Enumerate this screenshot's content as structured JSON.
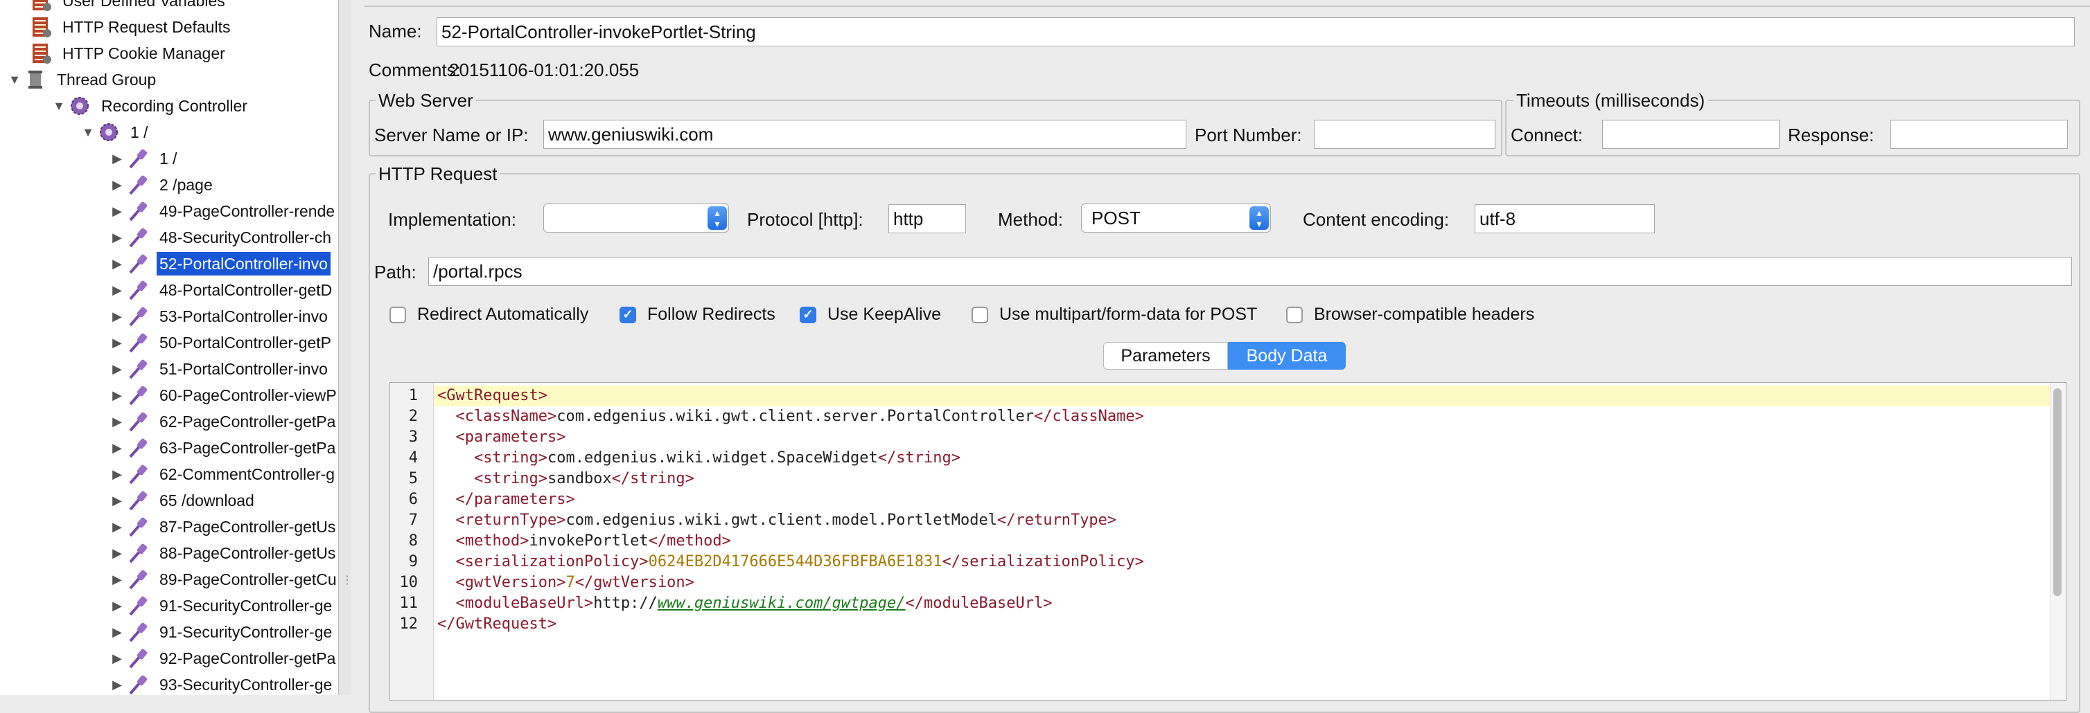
{
  "tree": {
    "items": [
      {
        "label": "User Defined Variables",
        "indent": 0,
        "toggle": "",
        "icon": "config"
      },
      {
        "label": "HTTP Request Defaults",
        "indent": 0,
        "toggle": "",
        "icon": "config"
      },
      {
        "label": "HTTP Cookie Manager",
        "indent": 0,
        "toggle": "",
        "icon": "config"
      },
      {
        "label": "Thread Group",
        "indent": -1,
        "toggle": "▼",
        "icon": "spool"
      },
      {
        "label": "Recording Controller",
        "indent": 1,
        "toggle": "▼",
        "icon": "gear"
      },
      {
        "label": "1 /",
        "indent": 2,
        "toggle": "▼",
        "icon": "gear"
      },
      {
        "label": "1 /",
        "indent": 3,
        "toggle": "▶",
        "icon": "pipette"
      },
      {
        "label": "2 /page",
        "indent": 3,
        "toggle": "▶",
        "icon": "pipette"
      },
      {
        "label": "49-PageController-rende",
        "indent": 3,
        "toggle": "▶",
        "icon": "pipette"
      },
      {
        "label": "48-SecurityController-ch",
        "indent": 3,
        "toggle": "▶",
        "icon": "pipette"
      },
      {
        "label": "52-PortalController-invo",
        "indent": 3,
        "toggle": "▶",
        "icon": "pipette",
        "selected": true
      },
      {
        "label": "48-PortalController-getD",
        "indent": 3,
        "toggle": "▶",
        "icon": "pipette"
      },
      {
        "label": "53-PortalController-invo",
        "indent": 3,
        "toggle": "▶",
        "icon": "pipette"
      },
      {
        "label": "50-PortalController-getP",
        "indent": 3,
        "toggle": "▶",
        "icon": "pipette"
      },
      {
        "label": "51-PortalController-invo",
        "indent": 3,
        "toggle": "▶",
        "icon": "pipette"
      },
      {
        "label": "60-PageController-viewP",
        "indent": 3,
        "toggle": "▶",
        "icon": "pipette"
      },
      {
        "label": "62-PageController-getPa",
        "indent": 3,
        "toggle": "▶",
        "icon": "pipette"
      },
      {
        "label": "63-PageController-getPa",
        "indent": 3,
        "toggle": "▶",
        "icon": "pipette"
      },
      {
        "label": "62-CommentController-g",
        "indent": 3,
        "toggle": "▶",
        "icon": "pipette"
      },
      {
        "label": "65 /download",
        "indent": 3,
        "toggle": "▶",
        "icon": "pipette"
      },
      {
        "label": "87-PageController-getUs",
        "indent": 3,
        "toggle": "▶",
        "icon": "pipette"
      },
      {
        "label": "88-PageController-getUs",
        "indent": 3,
        "toggle": "▶",
        "icon": "pipette"
      },
      {
        "label": "89-PageController-getCu",
        "indent": 3,
        "toggle": "▶",
        "icon": "pipette"
      },
      {
        "label": "91-SecurityController-ge",
        "indent": 3,
        "toggle": "▶",
        "icon": "pipette"
      },
      {
        "label": "91-SecurityController-ge",
        "indent": 3,
        "toggle": "▶",
        "icon": "pipette"
      },
      {
        "label": "92-PageController-getPa",
        "indent": 3,
        "toggle": "▶",
        "icon": "pipette"
      },
      {
        "label": "93-SecurityController-ge",
        "indent": 3,
        "toggle": "▶",
        "icon": "pipette"
      }
    ]
  },
  "form": {
    "name_label": "Name:",
    "name_value": "52-PortalController-invokePortlet-String",
    "comments_label": "Comments:",
    "comments_value": "20151106-01:01:20.055"
  },
  "web_server": {
    "title": "Web Server",
    "server_label": "Server Name or IP:",
    "server_value": "www.geniuswiki.com",
    "port_label": "Port Number:",
    "port_value": ""
  },
  "timeouts": {
    "title": "Timeouts (milliseconds)",
    "connect_label": "Connect:",
    "connect_value": "",
    "response_label": "Response:",
    "response_value": ""
  },
  "http_request": {
    "title": "HTTP Request",
    "implementation_label": "Implementation:",
    "implementation_value": "",
    "protocol_label": "Protocol [http]:",
    "protocol_value": "http",
    "method_label": "Method:",
    "method_value": "POST",
    "encoding_label": "Content encoding:",
    "encoding_value": "utf-8",
    "path_label": "Path:",
    "path_value": "/portal.rpcs",
    "options": [
      {
        "label": "Redirect Automatically",
        "checked": false
      },
      {
        "label": "Follow Redirects",
        "checked": true
      },
      {
        "label": "Use KeepAlive",
        "checked": true
      },
      {
        "label": "Use multipart/form-data for POST",
        "checked": false
      },
      {
        "label": "Browser-compatible headers",
        "checked": false
      }
    ],
    "tabs": [
      {
        "label": "Parameters",
        "active": false
      },
      {
        "label": "Body Data",
        "active": true
      }
    ]
  },
  "body": {
    "line_numbers": [
      "1",
      "2",
      "3",
      "4",
      "5",
      "6",
      "7",
      "8",
      "9",
      "10",
      "11",
      "12"
    ],
    "lines": [
      [
        {
          "t": "tag",
          "s": "<GwtRequest>"
        }
      ],
      [
        {
          "t": "txt",
          "s": "  "
        },
        {
          "t": "tag",
          "s": "<className>"
        },
        {
          "t": "txt",
          "s": "com.edgenius.wiki.gwt.client.server.PortalController"
        },
        {
          "t": "tag",
          "s": "</className>"
        }
      ],
      [
        {
          "t": "txt",
          "s": "  "
        },
        {
          "t": "tag",
          "s": "<parameters>"
        }
      ],
      [
        {
          "t": "txt",
          "s": "    "
        },
        {
          "t": "tag",
          "s": "<string>"
        },
        {
          "t": "txt",
          "s": "com.edgenius.wiki.widget.SpaceWidget"
        },
        {
          "t": "tag",
          "s": "</string>"
        }
      ],
      [
        {
          "t": "txt",
          "s": "    "
        },
        {
          "t": "tag",
          "s": "<string>"
        },
        {
          "t": "txt",
          "s": "sandbox"
        },
        {
          "t": "tag",
          "s": "</string>"
        }
      ],
      [
        {
          "t": "txt",
          "s": "  "
        },
        {
          "t": "tag",
          "s": "</parameters>"
        }
      ],
      [
        {
          "t": "txt",
          "s": "  "
        },
        {
          "t": "tag",
          "s": "<returnType>"
        },
        {
          "t": "txt",
          "s": "com.edgenius.wiki.gwt.client.model.PortletModel"
        },
        {
          "t": "tag",
          "s": "</returnType>"
        }
      ],
      [
        {
          "t": "txt",
          "s": "  "
        },
        {
          "t": "tag",
          "s": "<method>"
        },
        {
          "t": "txt",
          "s": "invokePortlet"
        },
        {
          "t": "tag",
          "s": "</method>"
        }
      ],
      [
        {
          "t": "txt",
          "s": "  "
        },
        {
          "t": "tag",
          "s": "<serializationPolicy>"
        },
        {
          "t": "val",
          "s": "0624EB2D417666E544D36FBFBA6E1831"
        },
        {
          "t": "tag",
          "s": "</serializationPolicy>"
        }
      ],
      [
        {
          "t": "txt",
          "s": "  "
        },
        {
          "t": "tag",
          "s": "<gwtVersion>"
        },
        {
          "t": "val",
          "s": "7"
        },
        {
          "t": "tag",
          "s": "</gwtVersion>"
        }
      ],
      [
        {
          "t": "txt",
          "s": "  "
        },
        {
          "t": "tag",
          "s": "<moduleBaseUrl>"
        },
        {
          "t": "txt",
          "s": "http://"
        },
        {
          "t": "link",
          "s": "www.geniuswiki.com/gwtpage/"
        },
        {
          "t": "tag",
          "s": "</moduleBaseUrl>"
        }
      ],
      [
        {
          "t": "tag",
          "s": "</GwtRequest>"
        }
      ]
    ]
  },
  "colors": {
    "selection": "#1756d6",
    "accent": "#3d8ef2",
    "tag": "#8a1a2c",
    "number": "#a57a00",
    "link": "#1b7a1b",
    "current_line": "#fdfbc4"
  }
}
